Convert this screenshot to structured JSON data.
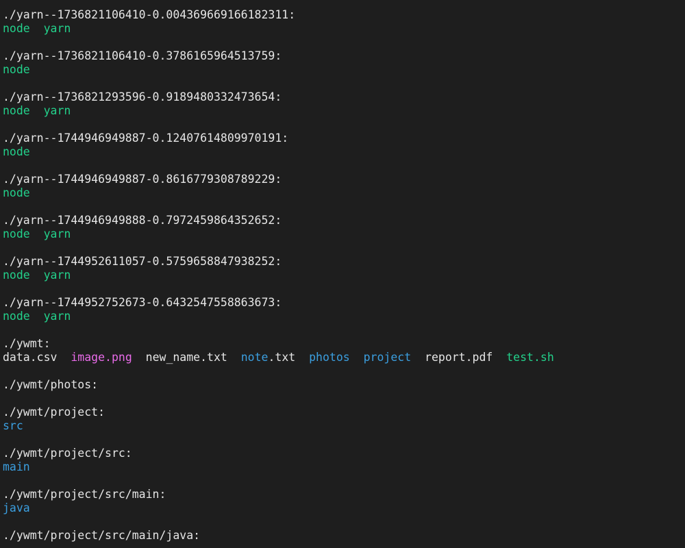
{
  "terminal": {
    "colors": {
      "background": "#1e1e1e",
      "text": "#e6e6e6",
      "executable": "#23d18b",
      "directory": "#3b9fe0",
      "image": "#e86be8",
      "cursor": "#c8c8c8"
    },
    "lines": [
      [
        {
          "text": "./yarn--1736821106410-0.004369669166182311:",
          "color": "white"
        }
      ],
      [
        {
          "text": "node",
          "color": "green"
        },
        {
          "text": "  ",
          "color": "white"
        },
        {
          "text": "yarn",
          "color": "green"
        }
      ],
      [],
      [
        {
          "text": "./yarn--1736821106410-0.3786165964513759:",
          "color": "white"
        }
      ],
      [
        {
          "text": "node",
          "color": "green"
        }
      ],
      [],
      [
        {
          "text": "./yarn--1736821293596-0.9189480332473654:",
          "color": "white"
        }
      ],
      [
        {
          "text": "node",
          "color": "green"
        },
        {
          "text": "  ",
          "color": "white"
        },
        {
          "text": "yarn",
          "color": "green"
        }
      ],
      [],
      [
        {
          "text": "./yarn--1744946949887-0.12407614809970191:",
          "color": "white"
        }
      ],
      [
        {
          "text": "node",
          "color": "green"
        }
      ],
      [],
      [
        {
          "text": "./yarn--1744946949887-0.8616779308789229:",
          "color": "white"
        }
      ],
      [
        {
          "text": "node",
          "color": "green"
        }
      ],
      [],
      [
        {
          "text": "./yarn--1744946949888-0.7972459864352652:",
          "color": "white"
        }
      ],
      [
        {
          "text": "node",
          "color": "green"
        },
        {
          "text": "  ",
          "color": "white"
        },
        {
          "text": "yarn",
          "color": "green"
        }
      ],
      [],
      [
        {
          "text": "./yarn--1744952611057-0.5759658847938252:",
          "color": "white"
        }
      ],
      [
        {
          "text": "node",
          "color": "green"
        },
        {
          "text": "  ",
          "color": "white"
        },
        {
          "text": "yarn",
          "color": "green"
        }
      ],
      [],
      [
        {
          "text": "./yarn--1744952752673-0.6432547558863673:",
          "color": "white"
        }
      ],
      [
        {
          "text": "node",
          "color": "green"
        },
        {
          "text": "  ",
          "color": "white"
        },
        {
          "text": "yarn",
          "color": "green"
        }
      ],
      [],
      [
        {
          "text": "./ywmt:",
          "color": "white"
        }
      ],
      [
        {
          "text": "data.csv",
          "color": "white"
        },
        {
          "text": "  ",
          "color": "white"
        },
        {
          "text": "image.png",
          "color": "pink"
        },
        {
          "text": "  ",
          "color": "white"
        },
        {
          "text": "new_name.txt",
          "color": "white"
        },
        {
          "text": "  ",
          "color": "white"
        },
        {
          "text": "note",
          "color": "blue"
        },
        {
          "text": ".txt",
          "color": "white"
        },
        {
          "text": "  ",
          "color": "white"
        },
        {
          "text": "photos",
          "color": "blue"
        },
        {
          "text": "  ",
          "color": "white"
        },
        {
          "text": "project",
          "color": "blue"
        },
        {
          "text": "  ",
          "color": "white"
        },
        {
          "text": "report.pdf",
          "color": "white"
        },
        {
          "text": "  ",
          "color": "white"
        },
        {
          "text": "test.sh",
          "color": "green"
        }
      ],
      [],
      [
        {
          "text": "./ywmt/photos:",
          "color": "white"
        }
      ],
      [],
      [
        {
          "text": "./ywmt/project:",
          "color": "white"
        }
      ],
      [
        {
          "text": "src",
          "color": "blue"
        }
      ],
      [],
      [
        {
          "text": "./ywmt/project/src:",
          "color": "white"
        }
      ],
      [
        {
          "text": "main",
          "color": "blue"
        }
      ],
      [],
      [
        {
          "text": "./ywmt/project/src/main:",
          "color": "white"
        }
      ],
      [
        {
          "text": "java",
          "color": "blue"
        }
      ],
      [],
      [
        {
          "text": "./ywmt/project/src/main/java:",
          "color": "white"
        }
      ]
    ]
  }
}
